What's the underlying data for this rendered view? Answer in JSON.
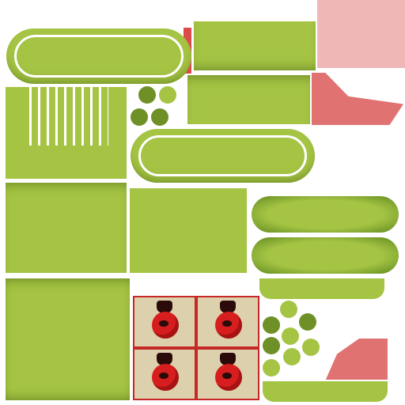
{
  "texture": {
    "colors": {
      "green": "#a5c444",
      "dark_green": "#5f8a1f",
      "pink": "#f0b7b7",
      "salmon": "#e17272",
      "tan": "#dcd0ad",
      "red": "#c62828"
    },
    "icon_names": [
      "stripe-panel",
      "ladybug-sprite",
      "dot-cluster",
      "pill-banner"
    ]
  }
}
